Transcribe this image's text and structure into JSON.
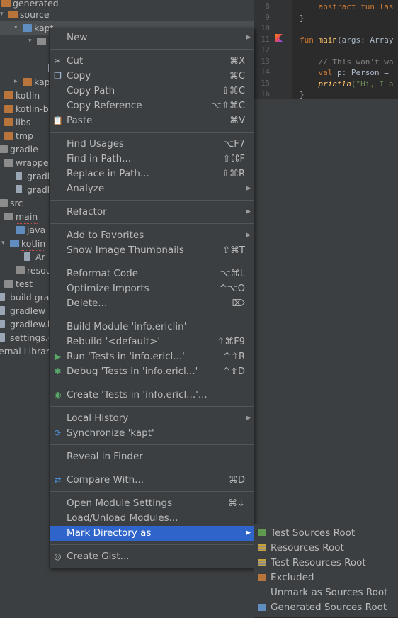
{
  "project_tree": {
    "rows": [
      {
        "label": "generated",
        "arrow": "▾",
        "icon": "folder-orange"
      },
      {
        "label": "source",
        "arrow": "▾",
        "icon": "folder-orange"
      },
      {
        "label": "kapt",
        "arrow": "▾",
        "icon": "folder-blue"
      },
      {
        "label": "",
        "arrow": "▾",
        "icon": "folder-gray"
      },
      {
        "label": "",
        "arrow": "",
        "icon": "file"
      },
      {
        "label": "kapt",
        "arrow": "▸",
        "icon": "folder-orange"
      },
      {
        "label": "kotlin",
        "arrow": "",
        "icon": "folder-orange"
      },
      {
        "label": "kotlin-bu",
        "arrow": "",
        "icon": "folder-orange"
      },
      {
        "label": "libs",
        "arrow": "",
        "icon": "folder-orange"
      },
      {
        "label": "tmp",
        "arrow": "",
        "icon": "folder-orange"
      },
      {
        "label": "gradle",
        "arrow": "",
        "icon": "folder-gray"
      },
      {
        "label": "wrapper",
        "arrow": "▾",
        "icon": "folder-gray"
      },
      {
        "label": "gradle",
        "arrow": "",
        "icon": "file"
      },
      {
        "label": "gradle",
        "arrow": "",
        "icon": "file"
      },
      {
        "label": "src",
        "arrow": "",
        "icon": "folder-gray"
      },
      {
        "label": "main",
        "arrow": "▾",
        "icon": "folder-gray"
      },
      {
        "label": "java",
        "arrow": "",
        "icon": "folder-blue"
      },
      {
        "label": "kotlin",
        "arrow": "▾",
        "icon": "folder-blue"
      },
      {
        "label": "Ar",
        "arrow": "",
        "icon": "file"
      },
      {
        "label": "resou",
        "arrow": "",
        "icon": "folder-gray"
      },
      {
        "label": "test",
        "arrow": "",
        "icon": "folder-gray"
      },
      {
        "label": "build.gradle",
        "arrow": "",
        "icon": "file"
      },
      {
        "label": "gradlew",
        "arrow": "",
        "icon": "file"
      },
      {
        "label": "gradlew.bat",
        "arrow": "",
        "icon": "file"
      },
      {
        "label": "settings.gra",
        "arrow": "",
        "icon": "file"
      },
      {
        "label": "ernal Librari",
        "arrow": "",
        "icon": "none"
      }
    ]
  },
  "editor": {
    "lines": [
      {
        "num": "8",
        "segments": [
          {
            "t": "    abstract fun las",
            "c": "kw"
          }
        ]
      },
      {
        "num": "9",
        "segments": [
          {
            "t": "}",
            "c": "pl"
          }
        ]
      },
      {
        "num": "10",
        "segments": [
          {
            "t": "",
            "c": "pl"
          }
        ]
      },
      {
        "num": "11",
        "segments": [
          {
            "t": "fun ",
            "c": "kw"
          },
          {
            "t": "main",
            "c": "fn"
          },
          {
            "t": "(args: Array",
            "c": "pl"
          }
        ]
      },
      {
        "num": "12",
        "segments": [
          {
            "t": "",
            "c": "pl"
          }
        ]
      },
      {
        "num": "13",
        "segments": [
          {
            "t": "    // This won't wo",
            "c": "cm"
          }
        ]
      },
      {
        "num": "14",
        "segments": [
          {
            "t": "    val ",
            "c": "kw"
          },
          {
            "t": "p: Person = ",
            "c": "pl"
          }
        ]
      },
      {
        "num": "15",
        "segments": [
          {
            "t": "    println",
            "c": "it"
          },
          {
            "t": "(\"Hi, I a",
            "c": "st"
          }
        ]
      },
      {
        "num": "16",
        "segments": [
          {
            "t": "}",
            "c": "pl"
          }
        ]
      }
    ]
  },
  "context_menu": {
    "items": [
      {
        "label": "New",
        "shortcut": "",
        "submenu": true,
        "icon": ""
      },
      {
        "sep": true
      },
      {
        "label": "Cut",
        "shortcut": "⌘X",
        "submenu": false,
        "icon": "scissors-icon"
      },
      {
        "label": "Copy",
        "shortcut": "⌘C",
        "submenu": false,
        "icon": "copy-icon"
      },
      {
        "label": "Copy Path",
        "shortcut": "⇧⌘C",
        "submenu": false,
        "icon": ""
      },
      {
        "label": "Copy Reference",
        "shortcut": "⌥⇧⌘C",
        "submenu": false,
        "icon": ""
      },
      {
        "label": "Paste",
        "shortcut": "⌘V",
        "submenu": false,
        "icon": "paste-icon"
      },
      {
        "sep": true
      },
      {
        "label": "Find Usages",
        "shortcut": "⌥F7",
        "submenu": false,
        "icon": ""
      },
      {
        "label": "Find in Path...",
        "shortcut": "⇧⌘F",
        "submenu": false,
        "icon": ""
      },
      {
        "label": "Replace in Path...",
        "shortcut": "⇧⌘R",
        "submenu": false,
        "icon": ""
      },
      {
        "label": "Analyze",
        "shortcut": "",
        "submenu": true,
        "icon": ""
      },
      {
        "sep": true
      },
      {
        "label": "Refactor",
        "shortcut": "",
        "submenu": true,
        "icon": ""
      },
      {
        "sep": true
      },
      {
        "label": "Add to Favorites",
        "shortcut": "",
        "submenu": true,
        "icon": ""
      },
      {
        "label": "Show Image Thumbnails",
        "shortcut": "⇧⌘T",
        "submenu": false,
        "icon": ""
      },
      {
        "sep": true
      },
      {
        "label": "Reformat Code",
        "shortcut": "⌥⌘L",
        "submenu": false,
        "icon": ""
      },
      {
        "label": "Optimize Imports",
        "shortcut": "^⌥O",
        "submenu": false,
        "icon": ""
      },
      {
        "label": "Delete...",
        "shortcut": "⌦",
        "submenu": false,
        "icon": ""
      },
      {
        "sep": true
      },
      {
        "label": "Build Module 'info.ericlin'",
        "shortcut": "",
        "submenu": false,
        "icon": ""
      },
      {
        "label": "Rebuild '<default>'",
        "shortcut": "⇧⌘F9",
        "submenu": false,
        "icon": ""
      },
      {
        "label": "Run 'Tests in 'info.ericl...'",
        "shortcut": "^⇧R",
        "submenu": false,
        "icon": "run-icon"
      },
      {
        "label": "Debug 'Tests in 'info.ericl...'",
        "shortcut": "^⇧D",
        "submenu": false,
        "icon": "debug-icon"
      },
      {
        "sep": true
      },
      {
        "label": "Create 'Tests in 'info.ericl...'...",
        "shortcut": "",
        "submenu": false,
        "icon": "create-test-icon"
      },
      {
        "sep": true
      },
      {
        "label": "Local History",
        "shortcut": "",
        "submenu": true,
        "icon": ""
      },
      {
        "label": "Synchronize 'kapt'",
        "shortcut": "",
        "submenu": false,
        "icon": "sync-icon"
      },
      {
        "sep": true
      },
      {
        "label": "Reveal in Finder",
        "shortcut": "",
        "submenu": false,
        "icon": ""
      },
      {
        "sep": true
      },
      {
        "label": "Compare With...",
        "shortcut": "⌘D",
        "submenu": false,
        "icon": "compare-icon"
      },
      {
        "sep": true
      },
      {
        "label": "Open Module Settings",
        "shortcut": "⌘↓",
        "submenu": false,
        "icon": ""
      },
      {
        "label": "Load/Unload Modules...",
        "shortcut": "",
        "submenu": false,
        "icon": ""
      },
      {
        "label": "Mark Directory as",
        "shortcut": "",
        "submenu": true,
        "icon": "",
        "selected": true
      },
      {
        "sep": true
      },
      {
        "label": "Create Gist...",
        "shortcut": "",
        "submenu": false,
        "icon": "github-icon"
      }
    ]
  },
  "mark_submenu": {
    "items": [
      {
        "label": "Test Sources Root",
        "icon": "folder-green",
        "color": "#5f9a4f"
      },
      {
        "label": "Resources Root",
        "icon": "resources-folder",
        "color": "#8c8c8c"
      },
      {
        "label": "Test Resources Root",
        "icon": "test-resources-folder",
        "color": "#8c8c8c"
      },
      {
        "label": "Excluded",
        "icon": "folder-orange",
        "color": "#b8743a"
      },
      {
        "label": "Unmark as Sources Root",
        "icon": "",
        "color": ""
      },
      {
        "label": "Generated Sources Root",
        "icon": "generated-sources-folder",
        "color": "#5f8dbf"
      }
    ]
  },
  "colors": {
    "selection": "#2f65ca",
    "panel": "#3c3f41",
    "editor_bg": "#2b2b2b"
  }
}
